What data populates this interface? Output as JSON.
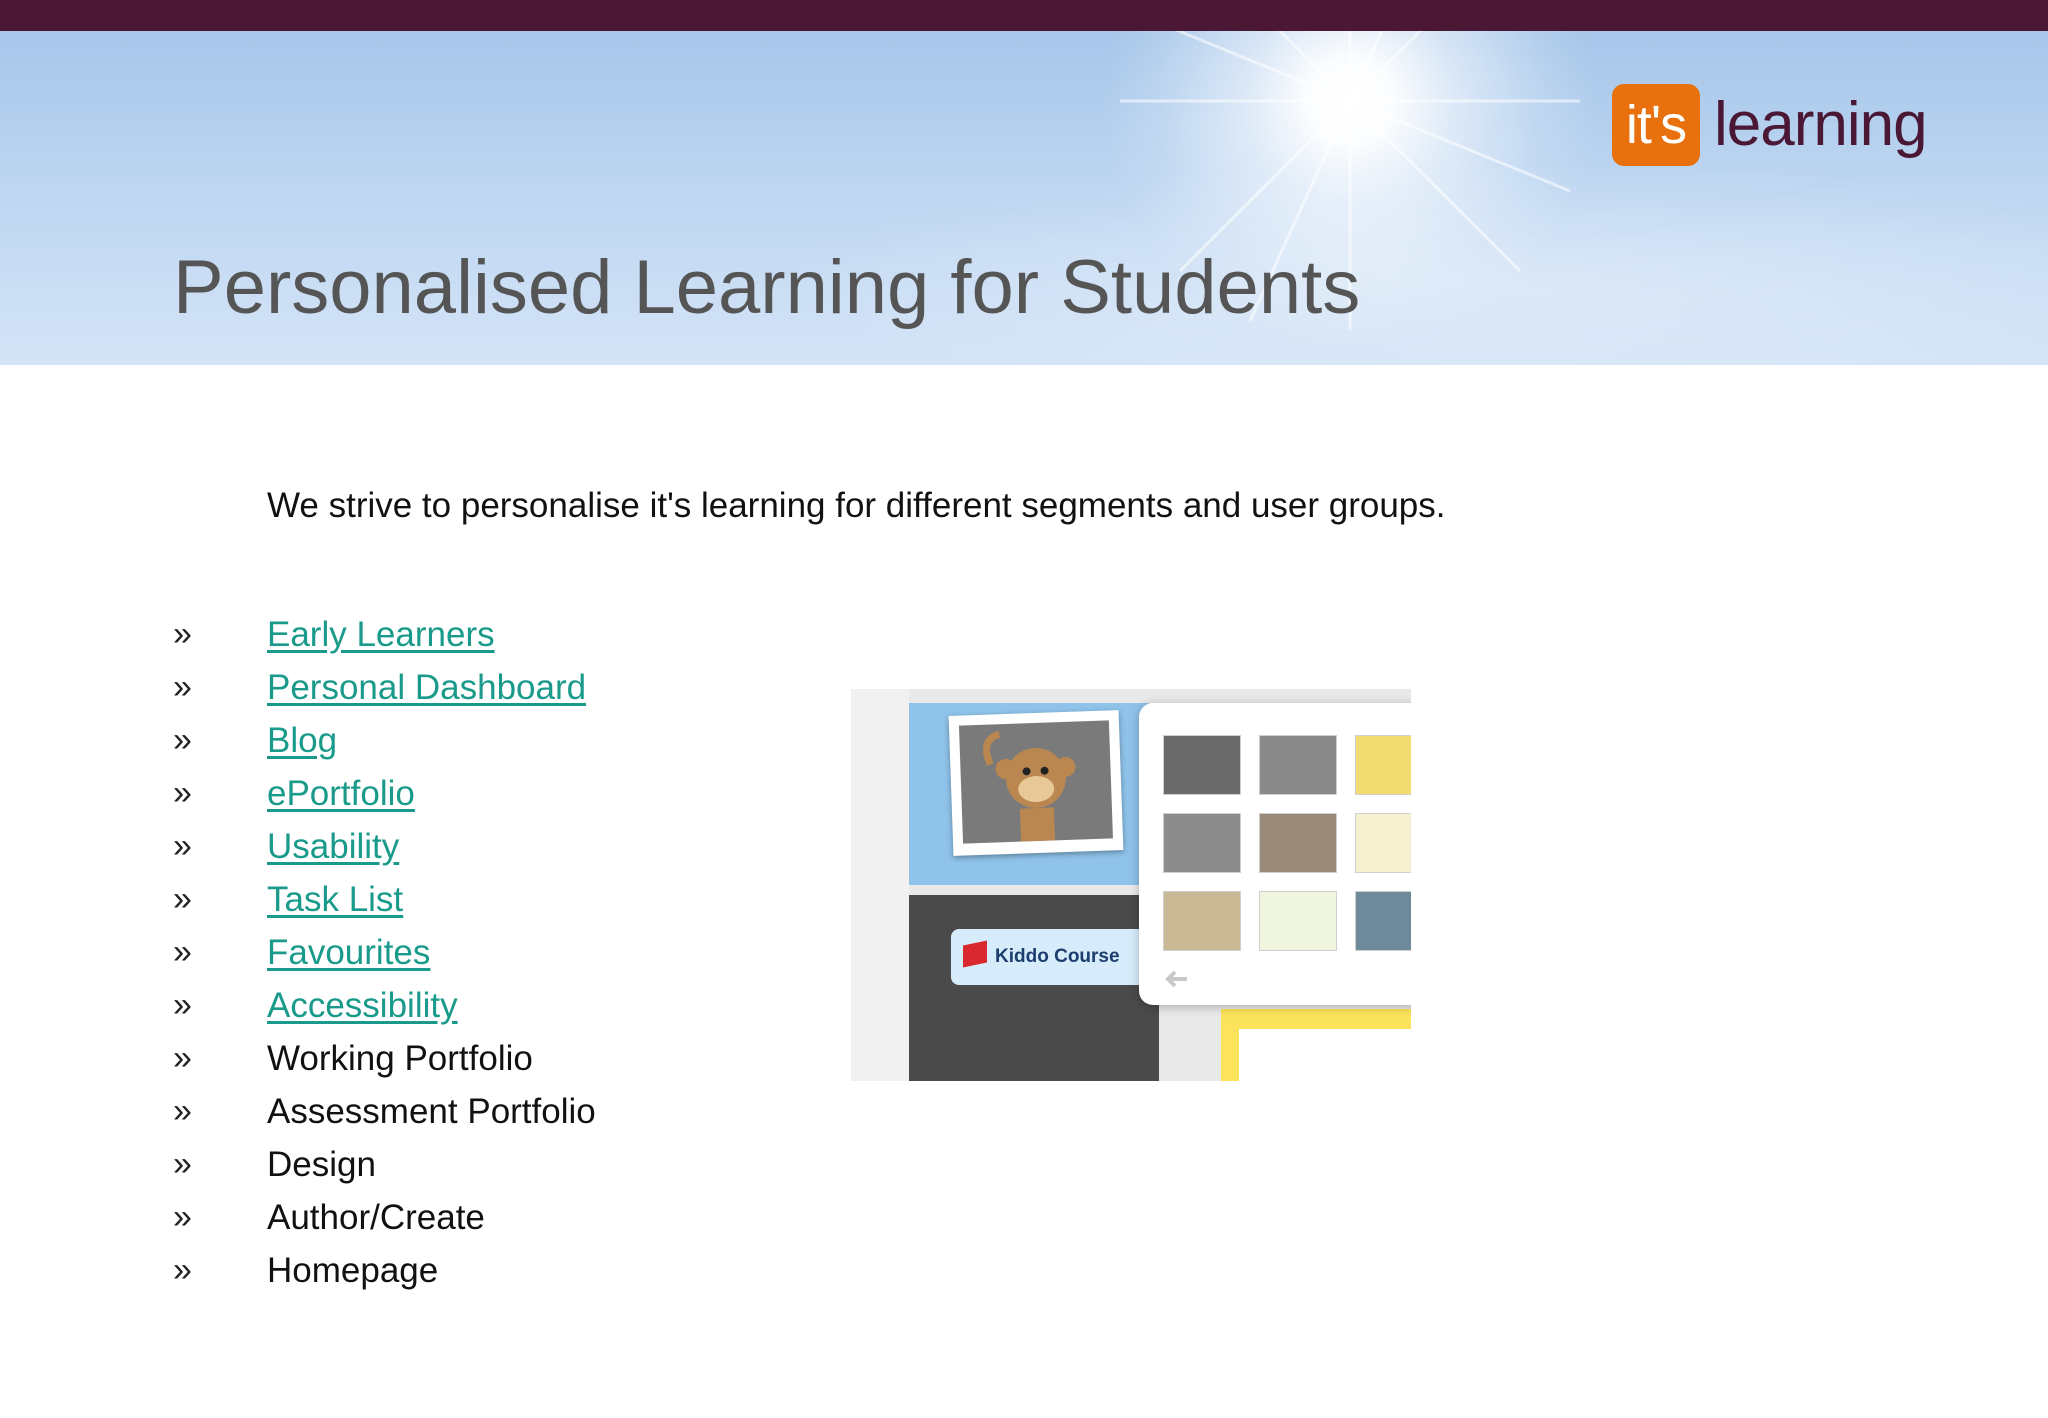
{
  "header": {
    "title": "Personalised Learning for Students",
    "logo": {
      "mark_text": "it's",
      "word_text": "learning",
      "mark_color": "#e8710e",
      "word_color": "#4a1834"
    },
    "top_bar_color": "#4a1834"
  },
  "intro": "We strive to personalise it's learning for different segments and user groups.",
  "bullet_glyph": "»",
  "link_color": "#1a9a8a",
  "topics": [
    {
      "label": "Early Learners",
      "is_link": true
    },
    {
      "label": "Personal Dashboard",
      "is_link": true
    },
    {
      "label": "Blog",
      "is_link": true
    },
    {
      "label": "ePortfolio",
      "is_link": true
    },
    {
      "label": "Usability",
      "is_link": true
    },
    {
      "label": "Task List",
      "is_link": true
    },
    {
      "label": "Favourites",
      "is_link": true
    },
    {
      "label": "Accessibility",
      "is_link": true
    },
    {
      "label": "Working Portfolio",
      "is_link": false
    },
    {
      "label": "Assessment Portfolio",
      "is_link": false
    },
    {
      "label": "Design",
      "is_link": false
    },
    {
      "label": "Author/Create",
      "is_link": false
    },
    {
      "label": "Homepage",
      "is_link": false
    }
  ],
  "screenshot": {
    "kiddo_label": "Kiddo Course"
  }
}
